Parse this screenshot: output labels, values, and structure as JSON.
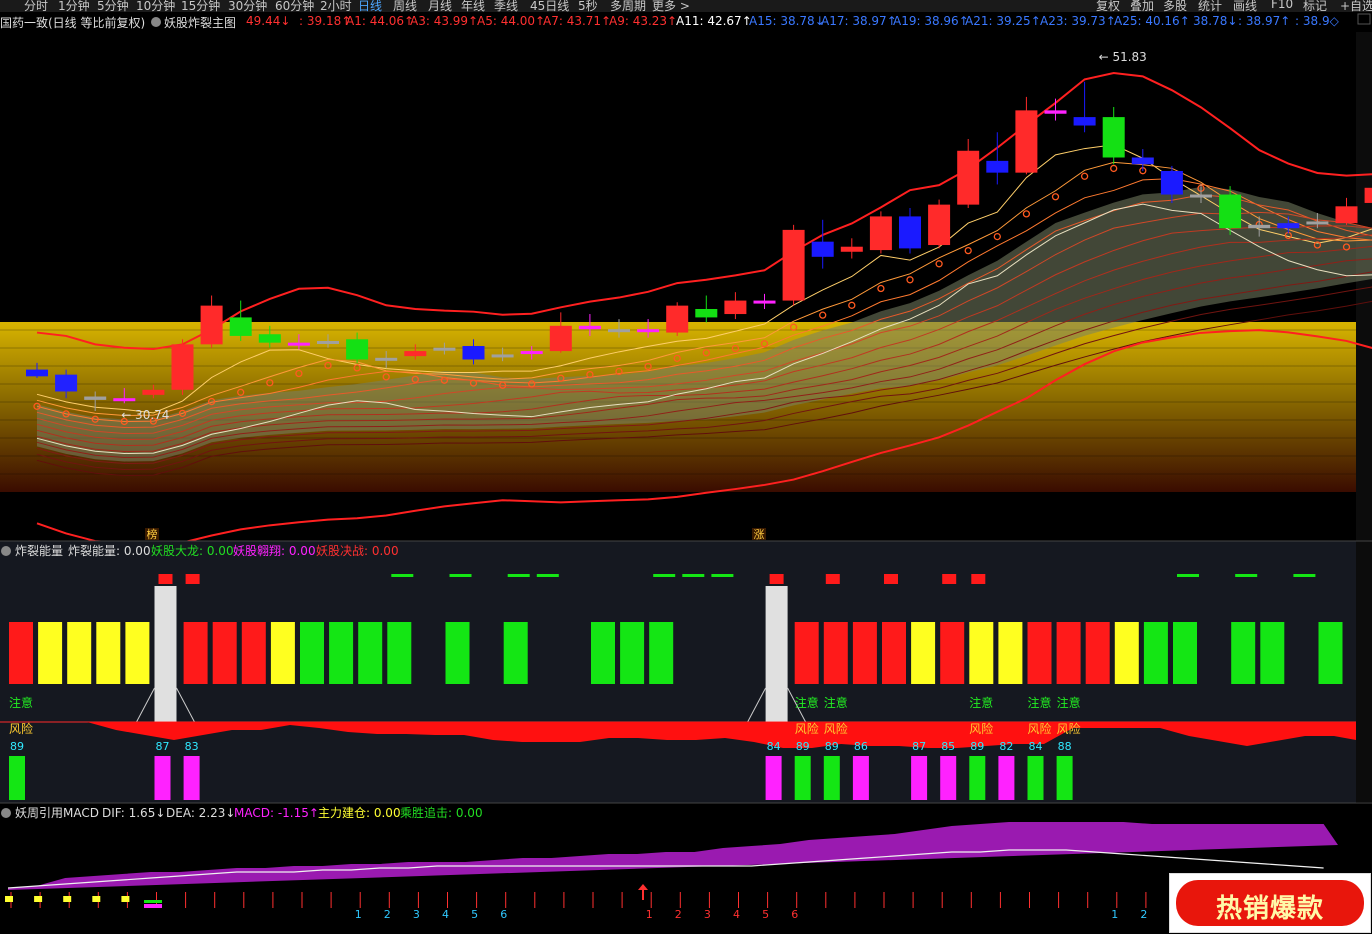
{
  "toolbar": {
    "left_items": [
      "分时",
      "1分钟",
      "5分钟",
      "10分钟",
      "15分钟",
      "30分钟",
      "60分钟",
      "2小时",
      "日线",
      "周线",
      "月线",
      "年线",
      "季线",
      "45日线",
      "5秒",
      "多周期",
      "更多 >"
    ],
    "active": "日线",
    "right_items": [
      "复权",
      "叠加",
      "多股",
      "统计",
      "画线",
      "F10",
      "标记",
      "+自选"
    ]
  },
  "main_header": {
    "title": "国药一致(日线 等比前复权)",
    "indicator": "妖股炸裂主图",
    "items": [
      {
        "text": "49.44↓",
        "color": "#ff3030"
      },
      {
        "text": ": 39.18↑",
        "color": "#ff3030"
      },
      {
        "text": "A1: 44.06↑",
        "color": "#ff3030"
      },
      {
        "text": "A3: 43.99↑",
        "color": "#ff3030"
      },
      {
        "text": "A5: 44.00↑",
        "color": "#ff3030"
      },
      {
        "text": "A7: 43.71↑",
        "color": "#ff3030"
      },
      {
        "text": "A9: 43.23↑",
        "color": "#ff3030"
      },
      {
        "text": "A11: 42.67↑",
        "color": "#ffffff"
      },
      {
        "text": "A15: 38.78↓",
        "color": "#3a78ff"
      },
      {
        "text": "A17: 38.97↑",
        "color": "#3a78ff"
      },
      {
        "text": "A19: 38.96↑",
        "color": "#3a78ff"
      },
      {
        "text": "A21: 39.25↑",
        "color": "#3a78ff"
      },
      {
        "text": "A23: 39.73↑",
        "color": "#3a78ff"
      },
      {
        "text": "A25: 40.16↑",
        "color": "#3a78ff"
      },
      {
        "text": "38.78↓",
        "color": "#3a78ff"
      },
      {
        "text": ": 38.97↑",
        "color": "#3a78ff"
      },
      {
        "text": ": 38.9◇",
        "color": "#3a78ff"
      }
    ]
  },
  "energy_header": {
    "title": "炸裂能量",
    "items": [
      {
        "text": "炸裂能量: 0.00",
        "color": "#dddddd"
      },
      {
        "text": "妖股大龙: 0.00",
        "color": "#22dd22"
      },
      {
        "text": "妖股翱翔: 0.00",
        "color": "#ff22ff"
      },
      {
        "text": "妖股决战: 0.00",
        "color": "#ff3030"
      }
    ]
  },
  "macd_header": {
    "title": "妖周引用MACD",
    "items": [
      {
        "text": "DIF: 1.65↓",
        "color": "#dddddd"
      },
      {
        "text": "DEA: 2.23↓",
        "color": "#dddddd"
      },
      {
        "text": "MACD: -1.15↑",
        "color": "#ff22ff"
      },
      {
        "text": "主力建仓: 0.00",
        "color": "#ffff33"
      },
      {
        "text": "乘胜追击: 0.00",
        "color": "#22dd22"
      }
    ]
  },
  "chart_data": {
    "type": "candlestick",
    "title": "国药一致(日线 等比前复权)",
    "annotations": {
      "high": "51.83",
      "low": "30.74",
      "markers": [
        "榜",
        "涨"
      ]
    },
    "candles_open_close_high_low": [
      [
        33.2,
        32.8,
        33.6,
        32.7
      ],
      [
        32.9,
        31.9,
        33.2,
        31.5
      ],
      [
        31.6,
        31.4,
        31.9,
        30.74
      ],
      [
        31.5,
        31.5,
        32.1,
        31.2
      ],
      [
        31.7,
        32.0,
        32.3,
        31.5
      ],
      [
        32.0,
        34.7,
        35.0,
        31.7
      ],
      [
        34.7,
        37.0,
        37.6,
        34.5
      ],
      [
        36.3,
        35.2,
        37.3,
        34.9
      ],
      [
        35.3,
        34.8,
        35.8,
        34.5
      ],
      [
        34.8,
        34.8,
        35.3,
        34.4
      ],
      [
        34.9,
        34.9,
        35.3,
        34.5
      ],
      [
        35.0,
        33.8,
        35.4,
        33.6
      ],
      [
        33.9,
        33.8,
        34.3,
        33.3
      ],
      [
        34.0,
        34.3,
        34.7,
        33.8
      ],
      [
        34.5,
        34.5,
        34.8,
        34.1
      ],
      [
        34.6,
        33.8,
        35.0,
        33.5
      ],
      [
        34.0,
        34.1,
        34.5,
        33.7
      ],
      [
        34.2,
        34.3,
        34.6,
        33.8
      ],
      [
        34.3,
        35.8,
        36.6,
        34.2
      ],
      [
        35.8,
        35.6,
        36.5,
        35.2
      ],
      [
        35.6,
        35.6,
        36.2,
        35.1
      ],
      [
        35.6,
        35.6,
        36.2,
        35.1
      ],
      [
        35.4,
        37.0,
        37.2,
        35.2
      ],
      [
        36.8,
        36.3,
        37.6,
        36.0
      ],
      [
        36.5,
        37.3,
        37.8,
        36.2
      ],
      [
        37.3,
        37.3,
        37.7,
        36.8
      ],
      [
        37.3,
        41.5,
        41.8,
        37.0
      ],
      [
        40.8,
        39.9,
        42.1,
        39.2
      ],
      [
        40.2,
        40.5,
        41.0,
        39.8
      ],
      [
        40.3,
        42.3,
        42.6,
        40.1
      ],
      [
        42.3,
        40.4,
        42.8,
        40.1
      ],
      [
        40.6,
        43.0,
        43.3,
        40.4
      ],
      [
        43.0,
        46.2,
        46.9,
        42.8
      ],
      [
        45.6,
        44.9,
        47.3,
        44.2
      ],
      [
        44.9,
        48.6,
        49.4,
        44.8
      ],
      [
        48.6,
        48.4,
        49.3,
        48.0
      ],
      [
        48.2,
        47.7,
        50.3,
        47.3
      ],
      [
        48.2,
        45.8,
        48.8,
        45.4
      ],
      [
        45.8,
        45.4,
        46.3,
        45.0
      ],
      [
        45.0,
        43.6,
        45.3,
        43.1
      ],
      [
        43.6,
        43.6,
        44.2,
        43.1
      ],
      [
        43.6,
        41.6,
        44.1,
        41.2
      ],
      [
        41.8,
        41.6,
        42.3,
        41.1
      ],
      [
        41.6,
        41.9,
        42.3,
        41.3
      ],
      [
        42.0,
        42.0,
        42.5,
        41.6
      ],
      [
        41.9,
        42.9,
        43.4,
        41.8
      ],
      [
        43.1,
        44.0,
        44.6,
        42.8
      ]
    ],
    "energy_bars": {
      "colors": [
        "red",
        "yellow",
        "yellow",
        "yellow",
        "yellow",
        "white",
        "red",
        "red",
        "red",
        "yellow",
        "green",
        "green",
        "green",
        "green",
        "none",
        "green",
        "none",
        "green",
        "none",
        "none",
        "green",
        "green",
        "green",
        "none",
        "none",
        "none",
        "white",
        "red",
        "red",
        "red",
        "red",
        "yellow",
        "red",
        "yellow",
        "yellow",
        "red",
        "red",
        "red",
        "yellow",
        "green",
        "green",
        "none",
        "green",
        "green",
        "none",
        "green",
        "none"
      ],
      "risk_numbers": {
        "0": "89",
        "5": "87",
        "6": "83",
        "26": "84",
        "27": "89",
        "28": "89",
        "29": "86",
        "31": "87",
        "32": "85",
        "33": "89",
        "34": "82",
        "35": "84",
        "36": "88"
      },
      "notes": [
        "注意",
        "风险"
      ]
    },
    "macd_ticks": [
      "1",
      "2",
      "3",
      "4",
      "5",
      "6",
      "1",
      "2",
      "3",
      "4",
      "5",
      "6",
      "1",
      "2"
    ]
  },
  "badge": {
    "text": "热销爆款"
  }
}
